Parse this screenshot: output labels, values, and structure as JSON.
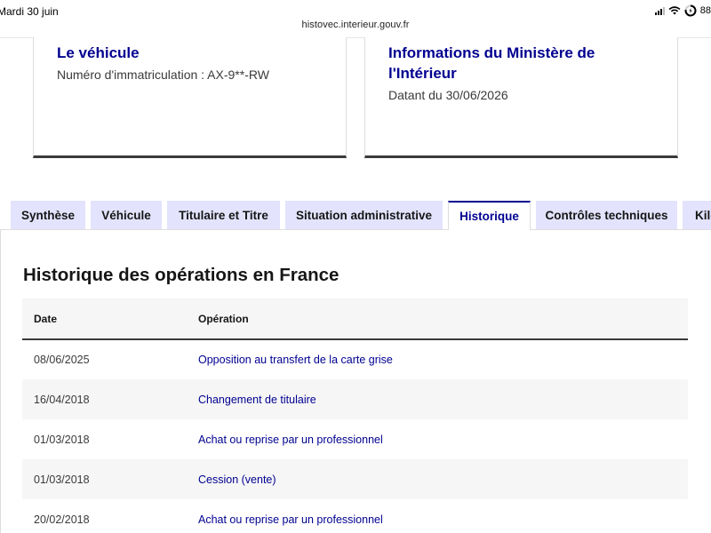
{
  "status_bar": {
    "time": "Mardi 30 juin",
    "battery_text": "88"
  },
  "browser": {
    "url": "histovec.interieur.gouv.fr"
  },
  "cards": {
    "vehicle": {
      "title": "Le véhicule",
      "description": "Numéro d'immatriculation : AX-9**-RW"
    },
    "ministry": {
      "title": "Informations du Ministère de l'Intérieur",
      "description": "Datant du 30/06/2026"
    }
  },
  "tabs": [
    {
      "label": "Synthèse",
      "active": false
    },
    {
      "label": "Véhicule",
      "active": false
    },
    {
      "label": "Titulaire et Titre",
      "active": false
    },
    {
      "label": "Situation administrative",
      "active": false
    },
    {
      "label": "Historique",
      "active": true
    },
    {
      "label": "Contrôles techniques",
      "active": false
    },
    {
      "label": "Kilo",
      "active": false
    }
  ],
  "history": {
    "title": "Historique des opérations en France",
    "columns": {
      "date": "Date",
      "operation": "Opération"
    },
    "rows": [
      {
        "date": "08/06/2025",
        "operation": "Opposition au transfert de la carte grise"
      },
      {
        "date": "16/04/2018",
        "operation": "Changement de titulaire"
      },
      {
        "date": "01/03/2018",
        "operation": "Achat ou reprise par un professionnel"
      },
      {
        "date": "01/03/2018",
        "operation": "Cession (vente)"
      },
      {
        "date": "20/02/2018",
        "operation": "Achat ou reprise par un professionnel"
      }
    ]
  },
  "colors": {
    "accent": "#000091",
    "tab_background": "#e3e3fd",
    "row_stripe": "#f6f6f6"
  }
}
